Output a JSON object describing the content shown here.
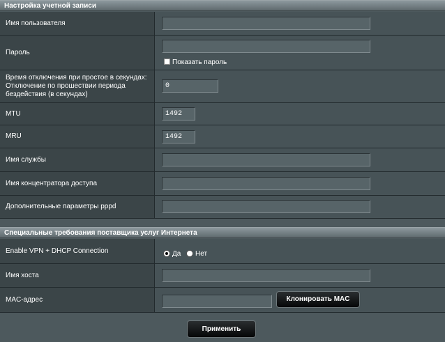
{
  "account_section": {
    "title": "Настройка учетной записи",
    "username_label": "Имя пользователя",
    "username_value": "",
    "password_label": "Пароль",
    "password_value": "",
    "show_password_label": "Показать пароль",
    "show_password_checked": false,
    "idle_label": "Время отключения при простое в секундах: Отключение по прошествии периода бездействия (в секундах)",
    "idle_value": "0",
    "mtu_label": "MTU",
    "mtu_value": "1492",
    "mru_label": "MRU",
    "mru_value": "1492",
    "service_label": "Имя службы",
    "service_value": "",
    "concentrator_label": "Имя концентратора доступа",
    "concentrator_value": "",
    "pppd_label": "Дополнительные параметры pppd",
    "pppd_value": ""
  },
  "isp_section": {
    "title": "Специальные требования поставщика услуг Интернета",
    "vpn_dhcp_label": "Enable VPN + DHCP Connection",
    "yes_label": "Да",
    "no_label": "Нет",
    "selected": "yes",
    "host_label": "Имя хоста",
    "host_value": "",
    "mac_label": "MAC-адрес",
    "mac_value": "",
    "clone_mac_button": "Клонировать MAC"
  },
  "apply_button": "Применить"
}
